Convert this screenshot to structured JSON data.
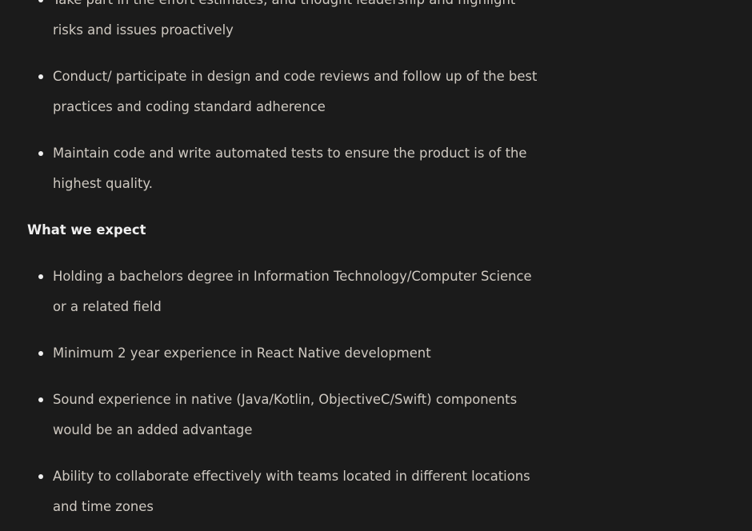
{
  "responsibilities": {
    "items": [
      "Take part in the effort estimates, and thought leadership and highlight risks and issues proactively",
      "Conduct/ participate in design and code reviews and follow up of the best practices and coding standard adherence",
      "Maintain code and write automated tests to ensure the product is of the highest quality."
    ]
  },
  "expectations": {
    "heading": "What we expect",
    "items": [
      "Holding a bachelors degree in Information Technology/Computer Science or a related field",
      "Minimum 2 year experience in React Native development",
      "Sound experience in native (Java/Kotlin, ObjectiveC/Swift) components would be an added advantage",
      "Ability to collaborate effectively with teams located in different locations and time zones"
    ]
  }
}
